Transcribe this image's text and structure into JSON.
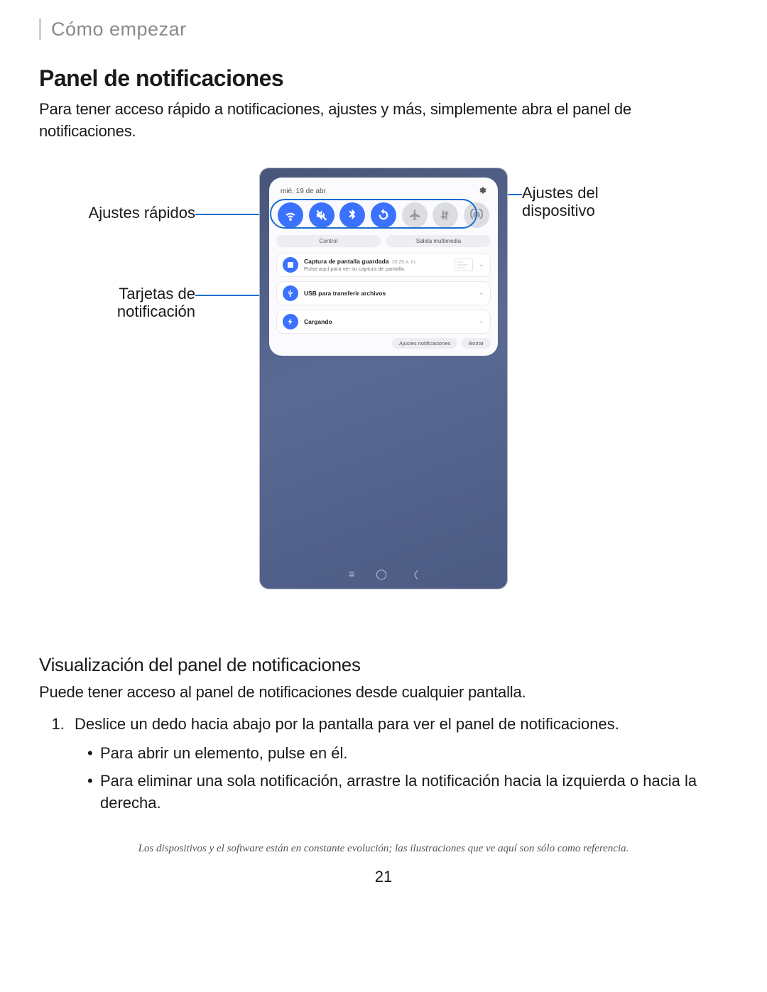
{
  "header": {
    "breadcrumb": "Cómo empezar"
  },
  "section": {
    "title": "Panel de notificaciones",
    "intro": "Para tener acceso rápido a notificaciones, ajustes y más, simplemente abra el panel de notificaciones."
  },
  "callouts": {
    "quick_settings": "Ajustes rápidos",
    "cards": "Tarjetas de notificación",
    "device_settings_l1": "Ajustes del",
    "device_settings_l2": "dispositivo"
  },
  "phone": {
    "date": "mié, 19 de abr",
    "quick_settings": [
      {
        "name": "wifi",
        "on": true
      },
      {
        "name": "mute",
        "on": true
      },
      {
        "name": "bluetooth",
        "on": true
      },
      {
        "name": "rotate",
        "on": true
      },
      {
        "name": "airplane",
        "on": false
      },
      {
        "name": "data",
        "on": false
      },
      {
        "name": "hotspot",
        "on": false
      }
    ],
    "tabs": {
      "control": "Control",
      "media": "Salida multimedia"
    },
    "notifications": [
      {
        "icon": "image",
        "title": "Captura de pantalla guardada",
        "time": "10:25 a. m.",
        "subtitle": "Pulse aquí para ver su captura de pantalla.",
        "thumb": true
      },
      {
        "icon": "usb",
        "title": "USB para transferir archivos",
        "time": "",
        "subtitle": "",
        "thumb": false
      },
      {
        "icon": "bolt",
        "title": "Cargando",
        "time": "",
        "subtitle": "",
        "thumb": false
      }
    ],
    "footer": {
      "settings": "Ajustes notificaciones",
      "clear": "Borrar"
    }
  },
  "subsection": {
    "title": "Visualización del panel de notificaciones",
    "body": "Puede tener acceso al panel de notificaciones desde cualquier pantalla.",
    "step1": "Deslice un dedo hacia abajo por la pantalla para ver el panel de notificaciones.",
    "bullets": [
      "Para abrir un elemento, pulse en él.",
      "Para eliminar una sola notificación, arrastre la notificación hacia la izquierda o hacia la derecha."
    ]
  },
  "footnote": "Los dispositivos y el software están en constante evolución; las ilustraciones que ve aquí son sólo como referencia.",
  "page_number": "21"
}
